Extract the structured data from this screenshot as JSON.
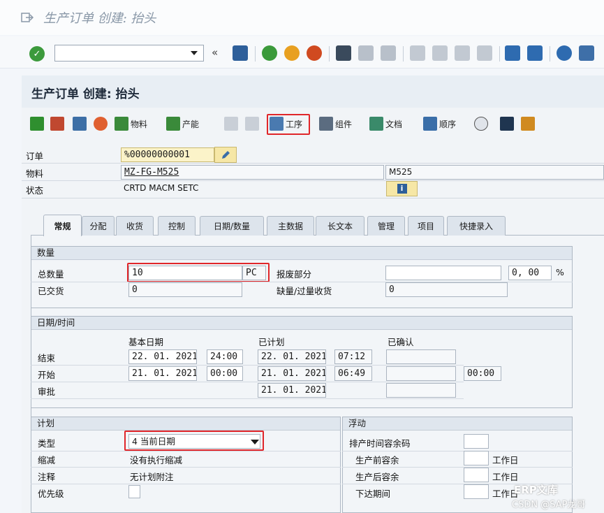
{
  "window": {
    "title": "生产订单 创建: 抬头"
  },
  "stdbar": {
    "nav_back_glyph": "«"
  },
  "screen": {
    "title": "生产订单 创建: 抬头"
  },
  "apptoolbar": {
    "material_label": "物料",
    "capacity_label": "产能",
    "operations_label": "工序",
    "components_label": "组件",
    "documents_label": "文档",
    "sequence_label": "顺序"
  },
  "header": {
    "order_label": "订单",
    "order_value": "%00000000001",
    "material_label": "物料",
    "material_value": "MZ-FG-M525",
    "material_desc": "M525",
    "status_label": "状态",
    "status_value": "CRTD MACM SETC"
  },
  "tabs": [
    "常规",
    "分配",
    "收货",
    "控制",
    "日期/数量",
    "主数据",
    "长文本",
    "管理",
    "项目",
    "快捷录入"
  ],
  "quantity": {
    "group_title": "数量",
    "total_label": "总数量",
    "total_value": "10",
    "unit": "PC",
    "scrap_label": "报废部分",
    "scrap_value": "",
    "scrap_pct": "0, 00",
    "pct_sign": "%",
    "delivered_label": "已交货",
    "delivered_value": "0",
    "short_label": "缺量/过量收货",
    "short_value": "0"
  },
  "dates": {
    "group_title": "日期/时间",
    "basic_header": "基本日期",
    "planned_header": "已计划",
    "confirmed_header": "已确认",
    "finish_label": "结束",
    "finish_basic_date": "22. 01. 2021",
    "finish_basic_time": "24:00",
    "finish_sched_date": "22. 01. 2021",
    "finish_sched_time": "07:12",
    "start_label": "开始",
    "start_basic_date": "21. 01. 2021",
    "start_basic_time": "00:00",
    "start_sched_date": "21. 01. 2021",
    "start_sched_time": "06:49",
    "start_conf_time": "00:00",
    "release_label": "审批",
    "release_sched_date": "21. 01. 2021"
  },
  "scheduling": {
    "group_title": "计划",
    "type_label": "类型",
    "type_value": "4 当前日期",
    "reduction_label": "缩减",
    "reduction_value": "没有执行缩减",
    "note_label": "注释",
    "note_value": "无计划附注",
    "priority_label": "优先级"
  },
  "float": {
    "group_title": "浮动",
    "margin_key_label": "排产时间容余码",
    "before_label": "生产前容余",
    "after_label": "生产后容余",
    "release_label": "下达期间",
    "unit": "工作日"
  },
  "watermark": {
    "brand": "ERP文库",
    "credit": "CSDN @SAP龙哥"
  }
}
